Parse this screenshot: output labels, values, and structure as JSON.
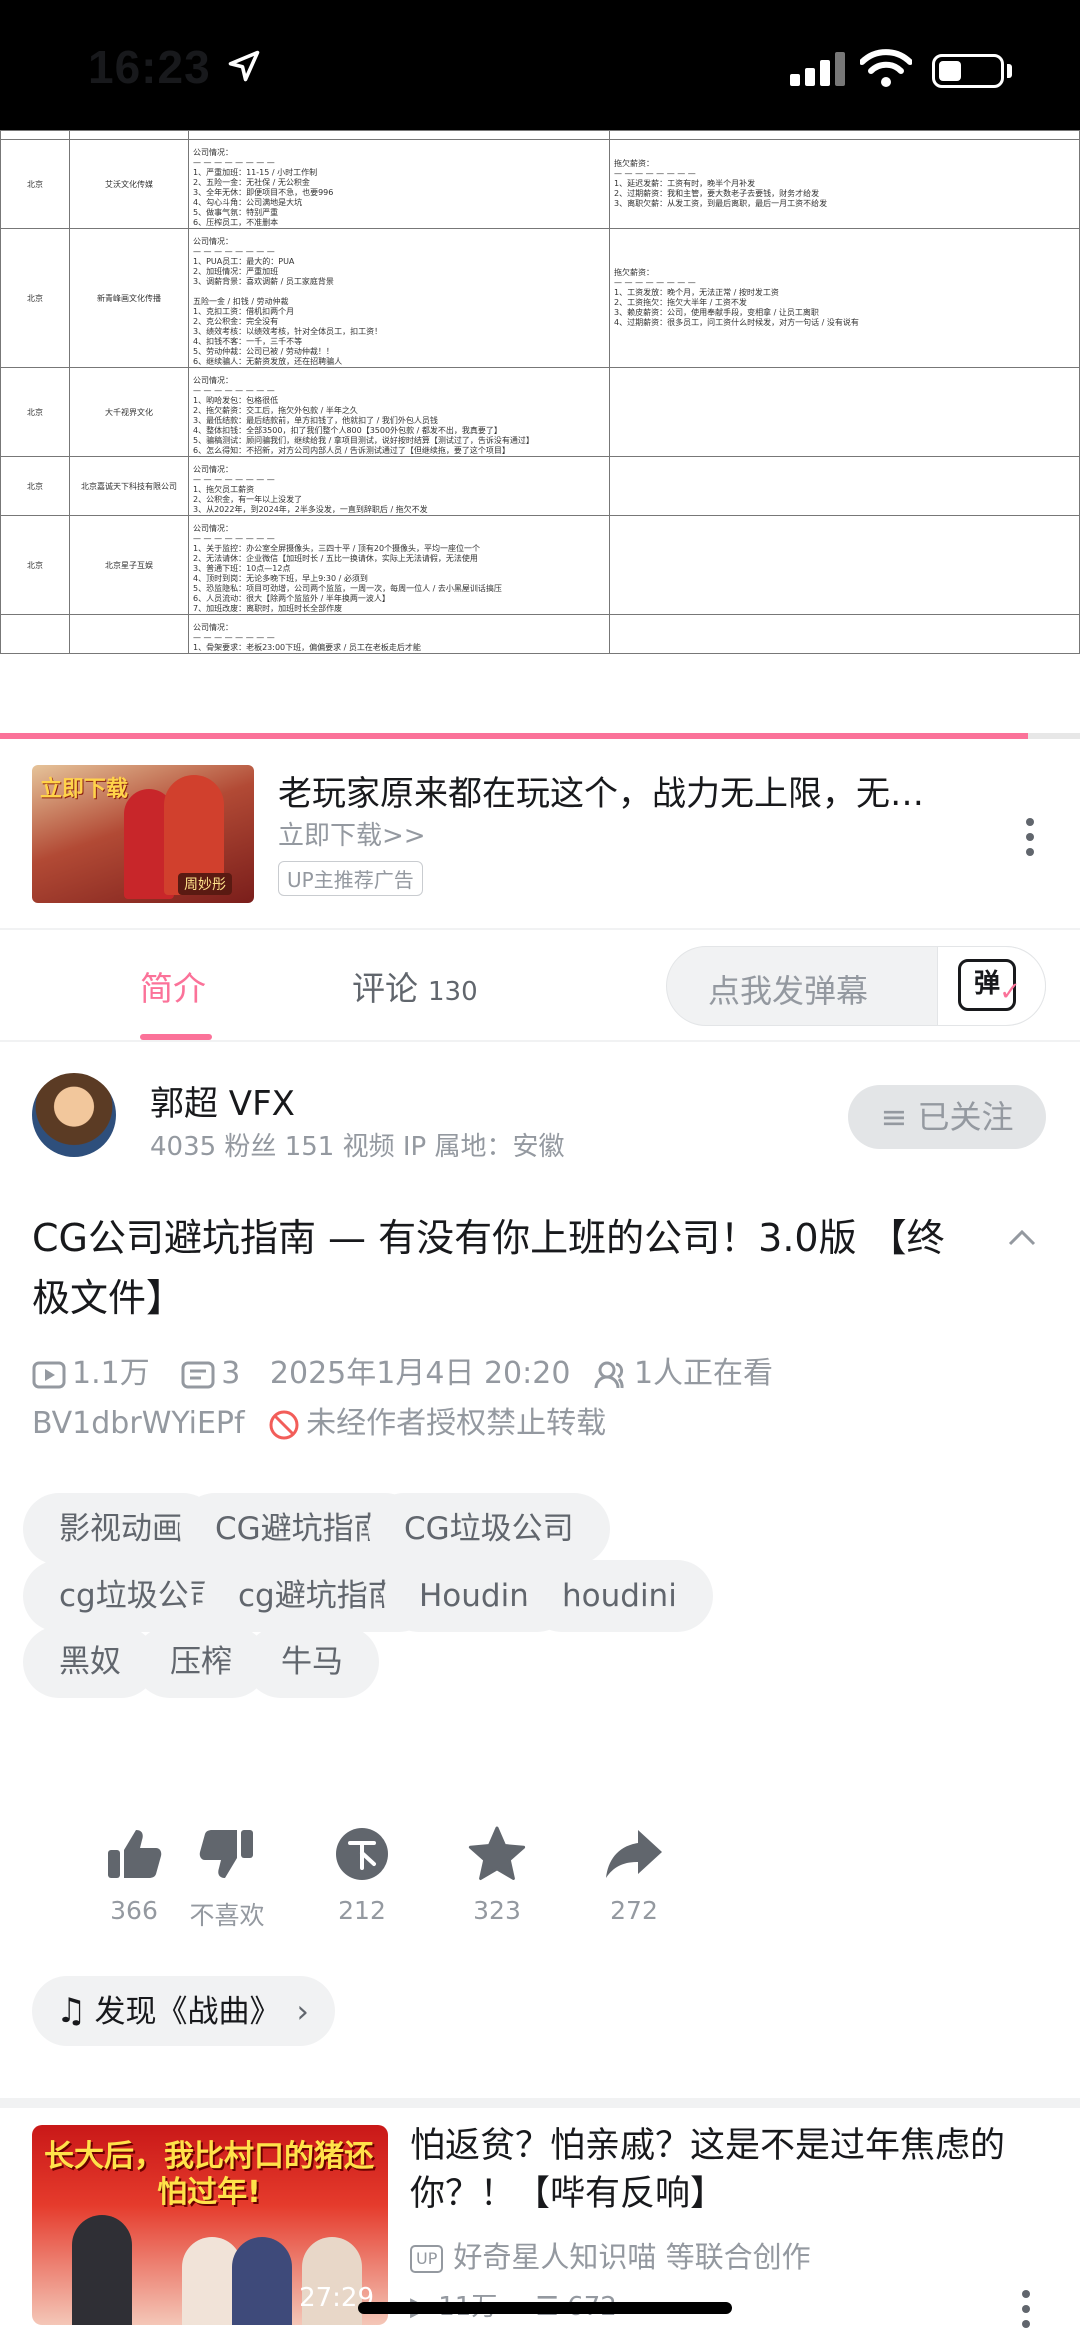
{
  "status_bar": {
    "time": "16:23"
  },
  "video": {
    "rows": [
      {
        "city": "北京",
        "company": "艾沃文化传媒",
        "situation": [
          "公司情况：",
          "— — — — — — — —",
          "1、严重加班：11-15 / 小时工作制",
          "2、五险一金：无社保 / 无公积金",
          "3、全年无休：即便项目不急，也要996",
          "4、勾心斗角：公司满地是大坑",
          "5、做事气氛：特别严重",
          "6、压榨员工，不准删本"
        ],
        "arrears": [
          "拖欠薪资：",
          "— — — — — — — —",
          "1、延迟发薪：工资有时，晚半个月补发",
          "2、过期薪资：我和主管，要大数老子去要钱，财务才给发",
          "3、离职欠薪：从发工资，到最后离职，最后一月工资不给发"
        ]
      },
      {
        "city": "北京",
        "company": "新青峰画文化传播",
        "situation": [
          "公司情况：",
          "— — — — — — — —",
          "1、PUA员工：最大的：PUA",
          "2、加班情况：严重加班",
          "3、调薪背景：喜欢调薪 / 员工家庭背景",
          "",
          "五险一金 / 扣钱 / 劳动仲裁",
          "1、克扣工资：借机扣两个月",
          "2、克公积金：完全没有",
          "3、绩效考核：以绩效考核，针对全体员工，扣工资！",
          "4、扣钱不客：一千，三千不等",
          "5、劳动仲裁：公司已被 / 劳动仲裁！！",
          "6、继续骗人：无薪资发放，还在招聘骗人"
        ],
        "arrears": [
          "拖欠薪资：",
          "— — — — — — — —",
          "1、工资发放：晚个月，无法正常 / 按时发工资",
          "2、工资拖欠：拖欠大半年 / 工资不发",
          "3、赖皮薪资：公司，使用奉献手段，变相拿 / 让员工离职",
          "4、过期薪资：很多员工，问工资什么时候发，对方一句话 / 没有说有"
        ]
      },
      {
        "city": "北京",
        "company": "大千视界文化",
        "situation": [
          "公司情况：",
          "— — — — — — — —",
          "1、哟哈发包：包格很低",
          "2、拖欠薪资：交工后，拖欠外包款 / 半年之久",
          "3、最低结款：最后结款前，单方扣钱了，他就扣了 / 我们外包人员钱",
          "4、整体扣钱：全部3500，扣了我们整个人800【3500外包款 / 都发不出，我真要了】",
          "5、骗稿测试：顾问骗我们，继续给我 / 拿项目测试，说好按时结算【测试过了，告诉没有通过】",
          "6、怎么得知：不招新，对方公司内部人员 / 告诉测试通过了【但继续拖，要了这个项目】"
        ],
        "arrears": []
      },
      {
        "city": "北京",
        "company": "北京嘉诚天下科技有限公司",
        "situation": [
          "公司情况：",
          "— — — — — — — —",
          "1、拖欠员工薪资",
          "2、公积金，有一年以上没发了",
          "3、从2022年，到2024年，2半多没发，一直到辞职后 / 拖欠不发"
        ],
        "arrears": []
      },
      {
        "city": "北京",
        "company": "北京星子互娱",
        "situation": [
          "公司情况：",
          "— — — — — — — —",
          "1、关于监控：办公室全屏摄像头，三四十平 / 顶有20个摄像头，平均一座位一个",
          "2、无法请休：企业微信【加班时长 / 五比一换请休，实际上无法请假，无法使用",
          "3、普通下班：10点—12点",
          "4、顶时到岗：无论多晚下班，早上9:30 / 必须到",
          "5、恐监隐私：项目可劲增，公司两个监监，一周一次，每周一位人 / 去小黑屋训话搞压",
          "6、人员流动：很大【除两个监监外 / 半年换两一波人】",
          "7、加班改废：离职时，加班时长全部作废"
        ],
        "arrears": []
      },
      {
        "city": "",
        "company": "",
        "situation": [
          "公司情况：",
          "— — — — — — — —",
          "1、骨架要求：老板23:00下班，偏偏要求 / 员工在老板走后才能"
        ],
        "arrears": []
      }
    ]
  },
  "ad": {
    "thumb_banner": "立即下载",
    "thumb_signature": "周妙彤",
    "title": "老玩家原来都在玩这个，战力无上限，无…",
    "cta": "立即下载>>",
    "tag": "UP主推荐广告"
  },
  "tabs": [
    {
      "label": "简介",
      "count": ""
    },
    {
      "label": "评论",
      "count": "130"
    }
  ],
  "danmaku": {
    "placeholder": "点我发弹幕",
    "icon_text": "弹"
  },
  "uploader": {
    "name": "郭超 VFX",
    "stats": "4035 粉丝   151 视频   IP 属地：安徽",
    "follow_label": "已关注"
  },
  "video_info": {
    "title": "CG公司避坑指南 — 有没有你上班的公司！3.0版   【终极文件】",
    "views": "1.1万",
    "danmaku_count": "3",
    "date": "2025年1月4日 20:20",
    "watching": "1人正在看",
    "bvid": "BV1dbrWYiEPf",
    "copyright": "未经作者授权禁止转载"
  },
  "tags": [
    "影视动画",
    "CG避坑指南",
    "CG垃圾公司",
    "cg垃圾公司",
    "cg避坑指南",
    "Houdini",
    "houdini",
    "黑奴",
    "压榨",
    "牛马"
  ],
  "actions": [
    {
      "icon": "like-icon",
      "label": "366"
    },
    {
      "icon": "dislike-icon",
      "label": "不喜欢"
    },
    {
      "icon": "coin-icon",
      "label": "212"
    },
    {
      "icon": "favorite-icon",
      "label": "323"
    },
    {
      "icon": "share-icon",
      "label": "272"
    }
  ],
  "music": {
    "label": "发现《战曲》"
  },
  "related": {
    "thumb_headline": "长大后，我比村口的猪还怕过年!",
    "duration": "27:29",
    "title": "怕返贫？怕亲戚？这是不是过年焦虑的你？！【哔有反响】",
    "up_badge": "UP",
    "author": "好奇星人知识喵  等联合创作",
    "views": "11万",
    "comments": "672"
  },
  "colors": {
    "accent": "#fb7299",
    "text": "#18191c",
    "muted": "#9499a0",
    "chip": "#f1f2f3"
  }
}
